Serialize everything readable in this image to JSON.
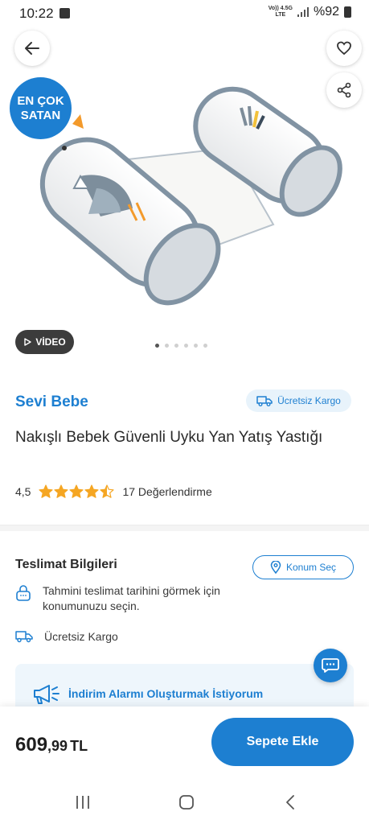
{
  "status_bar": {
    "time": "10:22",
    "network_top": "Vo)) 4.5G",
    "network_bottom": "LTE",
    "battery": "%92"
  },
  "hero": {
    "badge_line1": "EN ÇOK",
    "badge_line2": "SATAN",
    "video_label": "VİDEO",
    "image_count": 6,
    "active_image": 1
  },
  "product": {
    "brand": "Sevi Bebe",
    "shipping_pill": "Ücretsiz Kargo",
    "title": "Nakışlı Bebek Güvenli Uyku Yan Yatış Yastığı",
    "rating": "4,5",
    "rating_value": 4.5,
    "review_count": "17 Değerlendirme"
  },
  "delivery": {
    "title": "Teslimat Bilgileri",
    "location_button": "Konum Seç",
    "estimate_text": "Tahmini teslimat tarihini görmek için konumunuzu seçin.",
    "shipping_text": "Ücretsiz Kargo",
    "alarm_text": "İndirim Alarmı Oluşturmak İstiyorum"
  },
  "purchase": {
    "price_int": "609",
    "price_dec": ",99",
    "currency": "TL",
    "add_to_cart": "Sepete Ekle"
  },
  "colors": {
    "accent": "#1d7fd1",
    "star": "#f5a623"
  }
}
